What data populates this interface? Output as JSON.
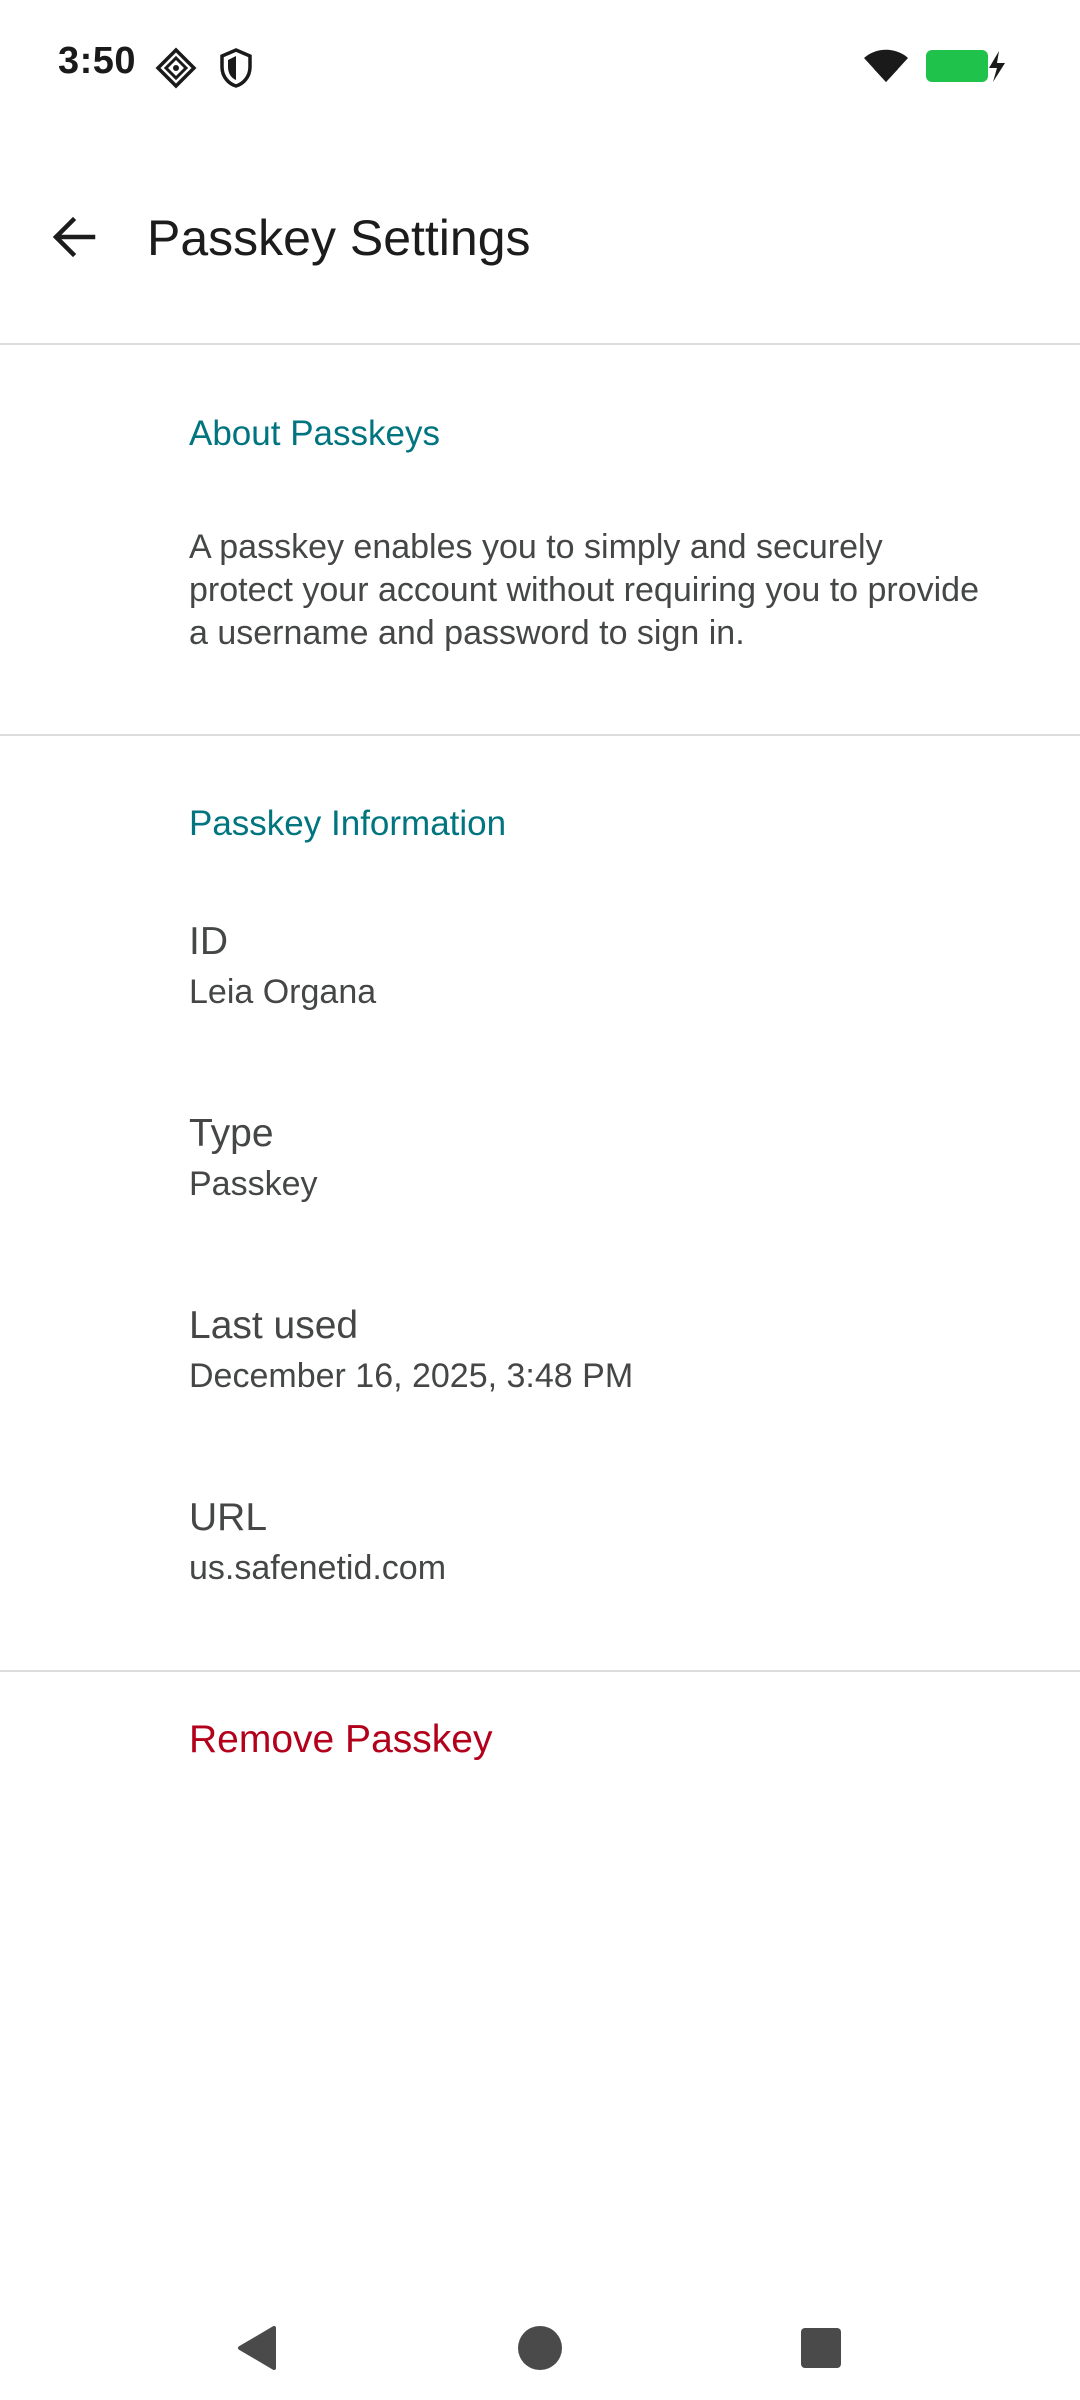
{
  "status_bar": {
    "time": "3:50",
    "icons": [
      "app-notification-icon",
      "shield-icon",
      "wifi-icon",
      "battery-charging-icon"
    ],
    "battery_color": "#1fc24a"
  },
  "app_bar": {
    "title": "Passkey Settings",
    "back_icon": "arrow-back-icon"
  },
  "about": {
    "header": "About Passkeys",
    "description": "A passkey enables you to simply and securely protect your account without requiring you to provide a username and password to sign in."
  },
  "info": {
    "header": "Passkey Information",
    "items": [
      {
        "label": "ID",
        "value": "Leia Organa"
      },
      {
        "label": "Type",
        "value": "Passkey"
      },
      {
        "label": "Last used",
        "value": "December 16, 2025, 3:48 PM"
      },
      {
        "label": "URL",
        "value": "us.safenetid.com"
      }
    ]
  },
  "actions": {
    "remove_label": "Remove Passkey"
  },
  "nav_bar": {
    "icons": [
      "nav-back-icon",
      "nav-home-icon",
      "nav-recents-icon"
    ]
  },
  "colors": {
    "accent": "#00757f",
    "danger": "#b3001b",
    "text": "#444746",
    "divider": "#dcdcdc"
  }
}
